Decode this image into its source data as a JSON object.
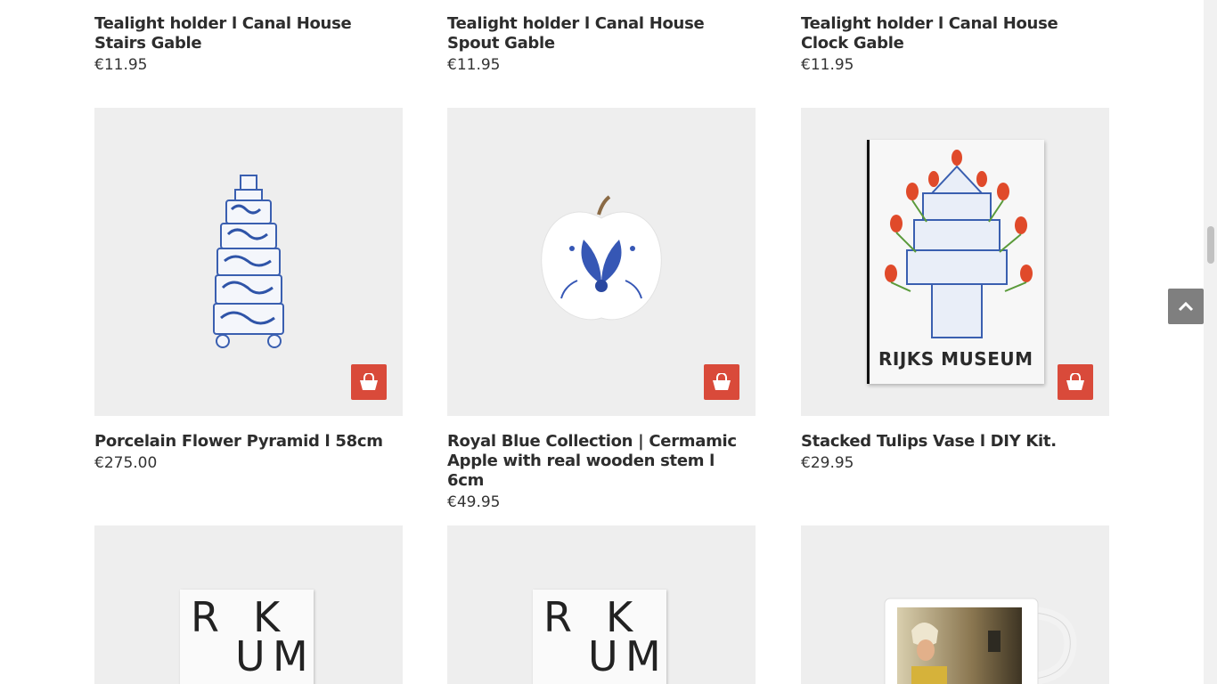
{
  "products_top": [
    {
      "name": "Tealight holder l Canal House Stairs Gable",
      "price": "€11.95"
    },
    {
      "name": "Tealight holder l Canal House Spout Gable",
      "price": "€11.95"
    },
    {
      "name": "Tealight holder l Canal House Clock Gable",
      "price": "€11.95"
    }
  ],
  "products_middle": [
    {
      "name": "Porcelain Flower Pyramid l 58cm",
      "price": "€275.00",
      "image": "blue-white-flower-pyramid"
    },
    {
      "name": "Royal Blue Collection | Cermamic Apple with real wooden stem l 6cm",
      "price": "€49.95",
      "image": "ceramic-apple"
    },
    {
      "name": "Stacked Tulips Vase l DIY Kit.",
      "price": "€29.95",
      "image": "tulip-vase-book"
    }
  ],
  "products_bottom": [
    {
      "image": "rijksmuseum-book"
    },
    {
      "image": "rijksmuseum-book"
    },
    {
      "image": "milkmaid-mug"
    }
  ],
  "book_cover_text": "RIJKS MUSEUM",
  "book_letters": {
    "l1": "R",
    "l2": "K",
    "l3": "U",
    "l4": "M"
  },
  "colors": {
    "cart_button": "#d94a3a",
    "card_background": "#eeeeee",
    "back_to_top": "#7f7f7f"
  },
  "icons": {
    "cart": "shopping-bag-icon",
    "back_to_top": "chevron-up-icon"
  }
}
